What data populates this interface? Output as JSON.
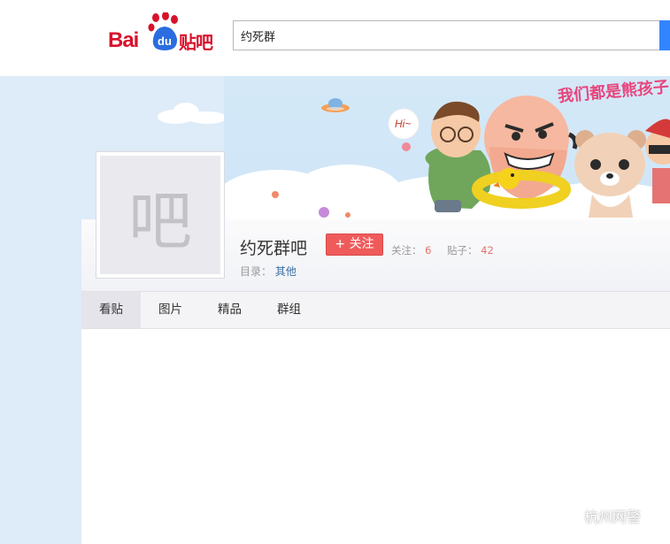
{
  "header": {
    "logo": {
      "bai": "Bai",
      "du": "du",
      "tieba": "贴吧"
    },
    "search": {
      "value": "约死群"
    }
  },
  "banner": {
    "slogan": "我们都是熊孩子",
    "speech": "Hi~"
  },
  "forum": {
    "avatar_char": "吧",
    "name": "约死群吧",
    "follow_label": "+ 关注",
    "follow_count_label": "关注：",
    "follow_count": "6",
    "post_count_label": "贴子：",
    "post_count": "42",
    "directory_label": "目录：",
    "directory_value": "其他"
  },
  "tabs": [
    {
      "label": "看贴",
      "active": true
    },
    {
      "label": "图片",
      "active": false
    },
    {
      "label": "精品",
      "active": false
    },
    {
      "label": "群组",
      "active": false
    }
  ],
  "watermark": {
    "text": "杭州网警",
    "icon": "wechat-icon"
  },
  "colors": {
    "brand_red": "#d8112a",
    "brand_blue": "#2b6de0",
    "follow_red": "#ef5b5b",
    "page_bg": "#deebf8",
    "search_button": "#3385ff"
  }
}
